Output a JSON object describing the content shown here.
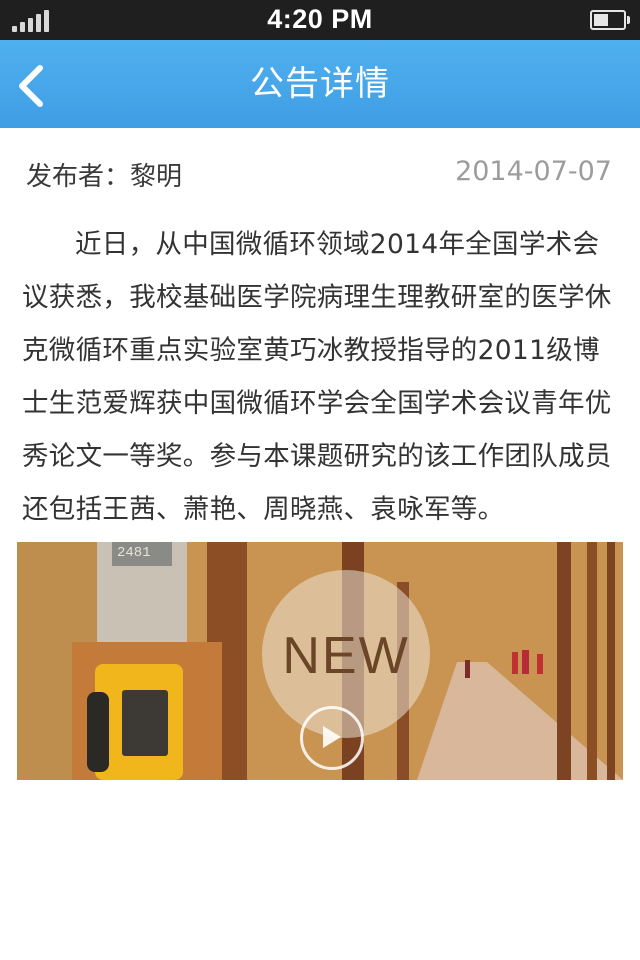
{
  "status_bar": {
    "time": "4:20 PM",
    "signal_icon": "signal-bars-icon",
    "battery_icon": "battery-icon"
  },
  "nav": {
    "title": "公告详情",
    "back_icon": "chevron-left-icon",
    "background_color": "#45a5e8"
  },
  "article": {
    "publisher": "发布者：黎明",
    "date": "2014-07-07",
    "body": "近日，从中国微循环领域2014年全国学术会议获悉，我校基础医学院病理生理教研室的医学休克微循环重点实验室黄巧冰教授指导的2011级博士生范爱辉获中国微循环学会全国学术会议青年优秀论文一等奖。参与本课题研究的该工作团队成员还包括王茜、萧艳、周晓燕、袁咏军等。"
  },
  "banner": {
    "badge_text": "NEW",
    "booth_number": "2481",
    "play_icon": "play-icon"
  }
}
